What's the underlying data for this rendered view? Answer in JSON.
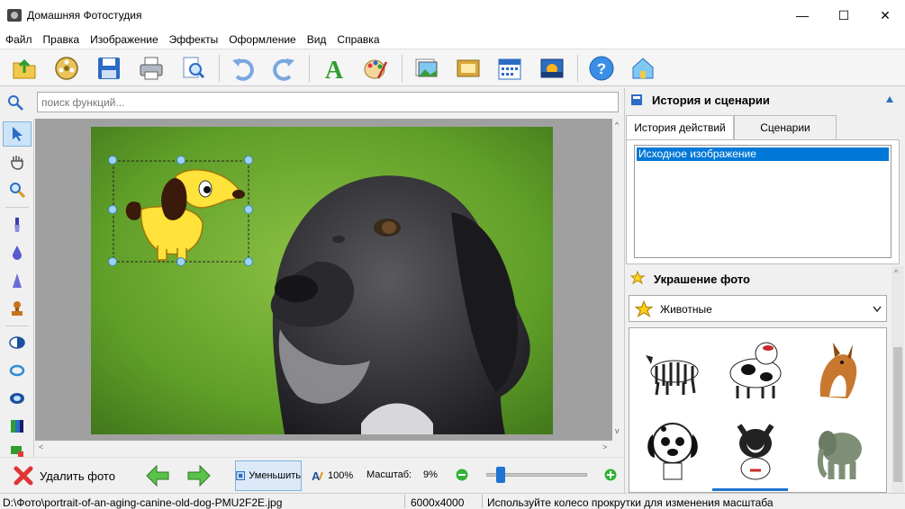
{
  "window": {
    "title": "Домашняя Фотостудия",
    "minimize": "—",
    "maximize": "☐",
    "close": "✕"
  },
  "menu": [
    "Файл",
    "Правка",
    "Изображение",
    "Эффекты",
    "Оформление",
    "Вид",
    "Справка"
  ],
  "search": {
    "placeholder": "поиск функций..."
  },
  "history_panel": {
    "title": "История и сценарии",
    "tabs": [
      "История действий",
      "Сценарии"
    ],
    "items": [
      "Исходное изображение"
    ]
  },
  "decor_panel": {
    "title": "Украшение фото",
    "category": "Животные"
  },
  "bottom": {
    "delete_label": "Удалить фото",
    "fit_label": "Уменьшить",
    "actual_label": "100%",
    "scale_label": "Масштаб:",
    "scale_value": "9%",
    "zoom_level": 0.09
  },
  "status": {
    "path": "D:\\Фото\\portrait-of-an-aging-canine-old-dog-PMU2F2E.jpg",
    "dimensions": "6000x4000",
    "hint": "Используйте колесо прокрутки для изменения масштаба"
  },
  "colors": {
    "accent": "#0078d7",
    "selection": "#9fd2f5"
  }
}
